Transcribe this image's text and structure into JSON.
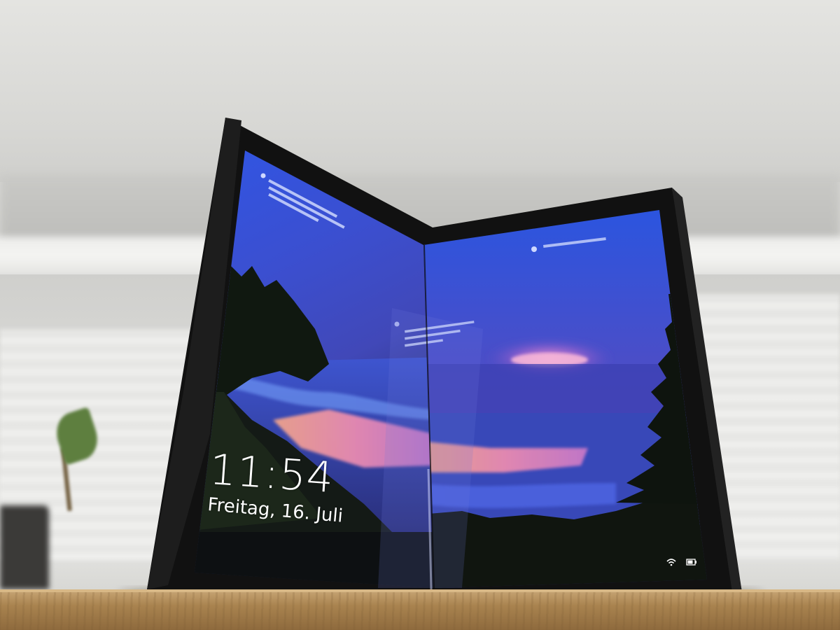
{
  "lock_screen": {
    "time": "11:54",
    "date": "Freitag, 16. Juli"
  },
  "status_icons": [
    "wifi-icon",
    "battery-icon"
  ],
  "colors": {
    "sky_top": "#2b4fd8",
    "sky_mid": "#4b4fc4",
    "sunset_pink": "#e58ab0",
    "bezel": "#141414",
    "shelf_wood": "#a9834f"
  }
}
